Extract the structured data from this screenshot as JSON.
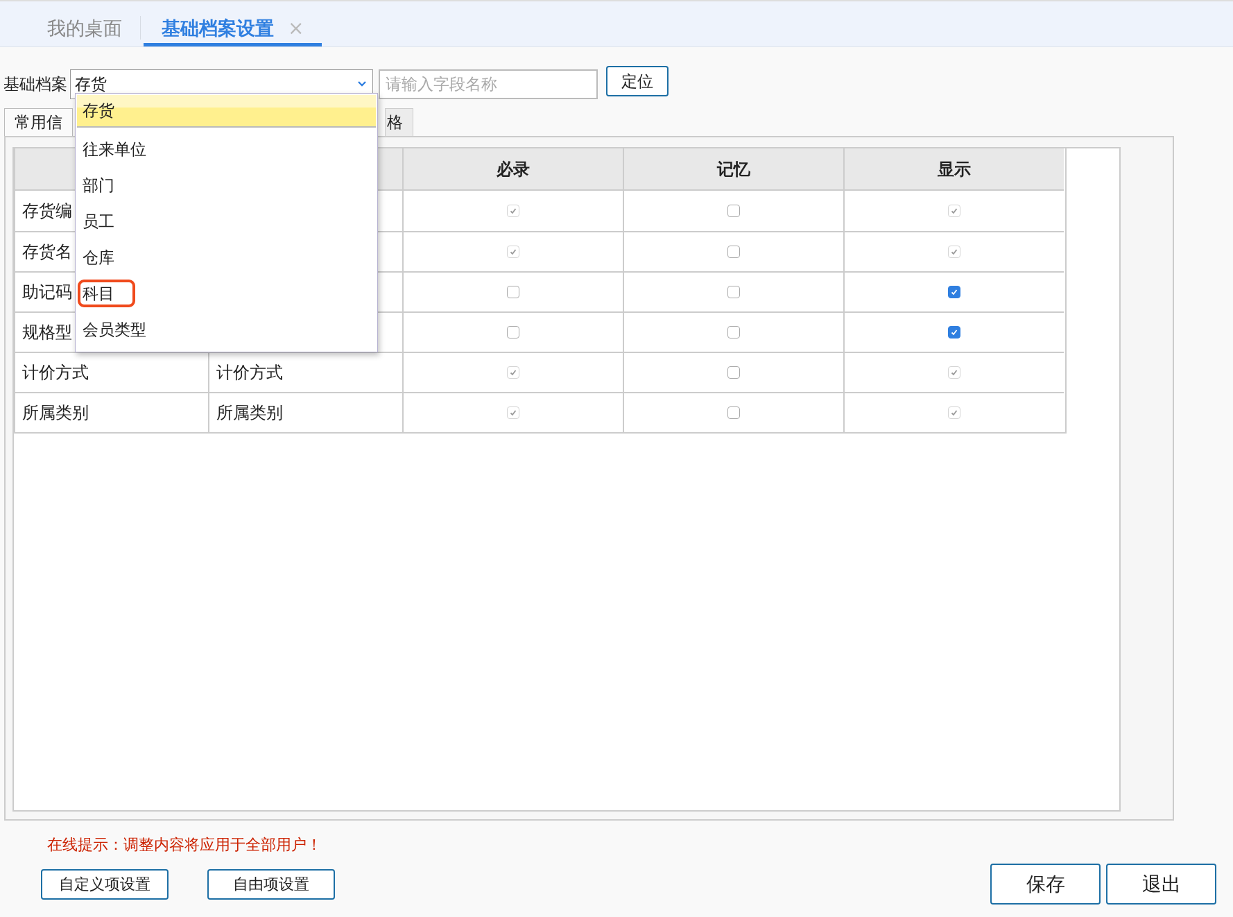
{
  "tabs": [
    {
      "label": "我的桌面",
      "selected": false
    },
    {
      "label": "基础档案设置",
      "selected": true,
      "close": "×"
    }
  ],
  "toolbar": {
    "label": "基础档案",
    "select_value": "存货",
    "search_placeholder": "请输入字段名称",
    "locate_button": "定位"
  },
  "dropdown": {
    "items": [
      {
        "label": "存货",
        "selected": true,
        "highlighted": false
      },
      {
        "label": "往来单位",
        "selected": false,
        "highlighted": false
      },
      {
        "label": "部门",
        "selected": false,
        "highlighted": false
      },
      {
        "label": "员工",
        "selected": false,
        "highlighted": false
      },
      {
        "label": "仓库",
        "selected": false,
        "highlighted": false
      },
      {
        "label": "科目",
        "selected": false,
        "highlighted": true
      },
      {
        "label": "会员类型",
        "selected": false,
        "highlighted": false
      }
    ]
  },
  "sub_tabs": [
    {
      "label": "常用信",
      "selected": true
    },
    {
      "label": "格",
      "selected": false
    }
  ],
  "table": {
    "columns": [
      "必录",
      "记忆",
      "显示"
    ],
    "rows": [
      {
        "column_1": "存货编",
        "required": {
          "checked": true,
          "disabled": true
        },
        "memory": {
          "checked": false,
          "disabled": false
        },
        "show": {
          "checked": true,
          "disabled": true
        }
      },
      {
        "column_1": "存货名",
        "required": {
          "checked": true,
          "disabled": true
        },
        "memory": {
          "checked": false,
          "disabled": false
        },
        "show": {
          "checked": true,
          "disabled": true
        }
      },
      {
        "column_1": "助记码",
        "required": {
          "checked": false,
          "disabled": false
        },
        "memory": {
          "checked": false,
          "disabled": false
        },
        "show": {
          "checked": true,
          "disabled": false
        }
      },
      {
        "column_1": "规格型",
        "required": {
          "checked": false,
          "disabled": false
        },
        "memory": {
          "checked": false,
          "disabled": false
        },
        "show": {
          "checked": true,
          "disabled": false
        }
      },
      {
        "column_1": "计价方式",
        "column_2": "计价方式",
        "required": {
          "checked": true,
          "disabled": true
        },
        "memory": {
          "checked": false,
          "disabled": false
        },
        "show": {
          "checked": true,
          "disabled": true
        }
      },
      {
        "column_1": "所属类别",
        "column_2": "所属类别",
        "required": {
          "checked": true,
          "disabled": true
        },
        "memory": {
          "checked": false,
          "disabled": false
        },
        "show": {
          "checked": true,
          "disabled": true
        }
      }
    ]
  },
  "notice": "在线提示：调整内容将应用于全部用户！",
  "left_buttons": [
    "自定义项设置",
    "自由项设置"
  ],
  "right_buttons": [
    "保存",
    "退出"
  ]
}
